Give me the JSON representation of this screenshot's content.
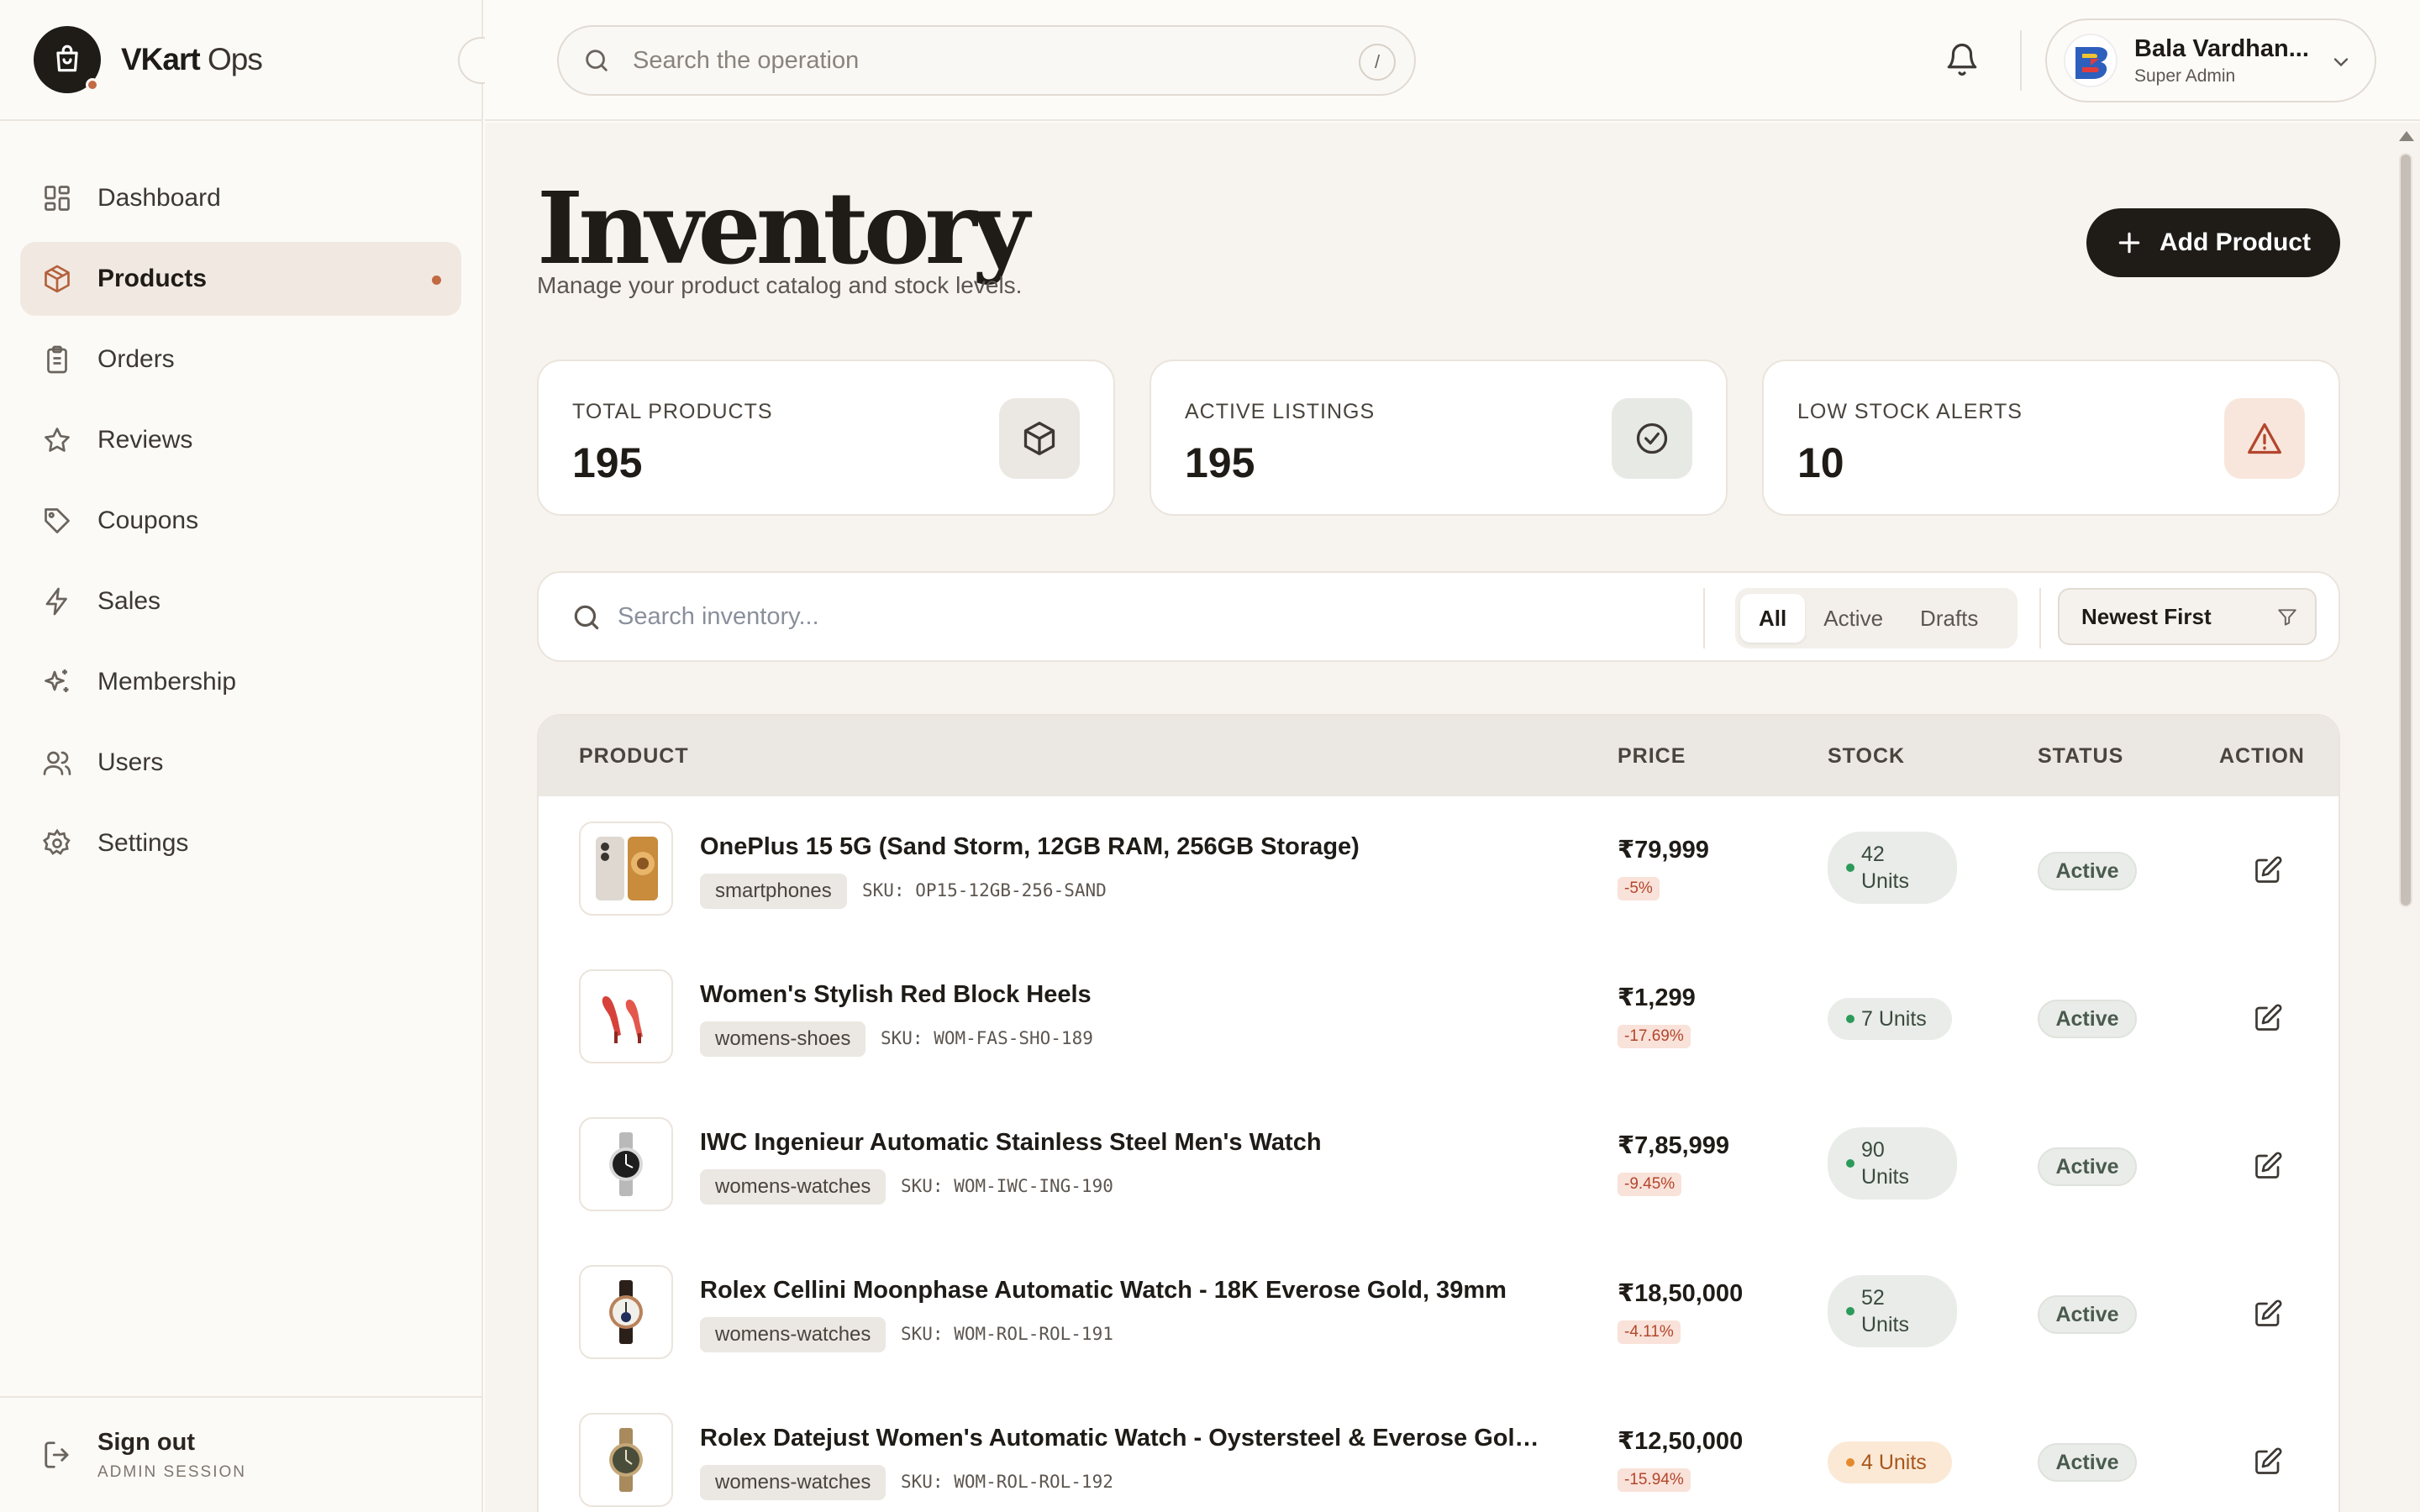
{
  "brand": {
    "bold": "VKart",
    "light": " Ops"
  },
  "nav": [
    {
      "label": "Dashboard",
      "icon": "dashboard-icon"
    },
    {
      "label": "Products",
      "icon": "box-icon",
      "active": true
    },
    {
      "label": "Orders",
      "icon": "clipboard-icon"
    },
    {
      "label": "Reviews",
      "icon": "star-icon"
    },
    {
      "label": "Coupons",
      "icon": "tag-icon"
    },
    {
      "label": "Sales",
      "icon": "lightning-icon"
    },
    {
      "label": "Membership",
      "icon": "sparkle-icon"
    },
    {
      "label": "Users",
      "icon": "users-icon"
    },
    {
      "label": "Settings",
      "icon": "gear-icon"
    }
  ],
  "signout": {
    "label": "Sign out",
    "sub": "ADMIN SESSION"
  },
  "topbar": {
    "search_placeholder": "Search the operation",
    "shortcut": "/",
    "user_name": "Bala Vardhan...",
    "user_role": "Super Admin"
  },
  "page": {
    "title": "Inventory",
    "subtitle": "Manage your product catalog and stock levels.",
    "add_label": "Add Product"
  },
  "stats": [
    {
      "label": "TOTAL PRODUCTS",
      "value": "195",
      "icon": "cube-icon"
    },
    {
      "label": "ACTIVE LISTINGS",
      "value": "195",
      "icon": "check-circle-icon"
    },
    {
      "label": "LOW STOCK ALERTS",
      "value": "10",
      "icon": "warning-icon"
    }
  ],
  "filters": {
    "search_placeholder": "Search inventory...",
    "tabs": [
      "All",
      "Active",
      "Drafts"
    ],
    "selected_tab": "All",
    "sort": "Newest First"
  },
  "table": {
    "headers": {
      "product": "PRODUCT",
      "price": "PRICE",
      "stock": "STOCK",
      "status": "STATUS",
      "action": "ACTION"
    },
    "rows": [
      {
        "name": "OnePlus 15 5G (Sand Storm, 12GB RAM, 256GB Storage)",
        "category": "smartphones",
        "sku": "SKU: OP15-12GB-256-SAND",
        "price": "₹79,999",
        "discount": "-5%",
        "stock_line1": "42",
        "stock_line2": "Units",
        "stock_level": "ok",
        "status": "Active",
        "thumb": "phone-image"
      },
      {
        "name": "Women's Stylish Red Block Heels",
        "category": "womens-shoes",
        "sku": "SKU: WOM-FAS-SHO-189",
        "price": "₹1,299",
        "discount": "-17.69%",
        "stock_line1": "7 Units",
        "stock_line2": "",
        "stock_level": "ok",
        "status": "Active",
        "thumb": "heels-image"
      },
      {
        "name": "IWC Ingenieur Automatic Stainless Steel Men's Watch",
        "category": "womens-watches",
        "sku": "SKU: WOM-IWC-ING-190",
        "price": "₹7,85,999",
        "discount": "-9.45%",
        "stock_line1": "90",
        "stock_line2": "Units",
        "stock_level": "ok",
        "status": "Active",
        "thumb": "watch-image"
      },
      {
        "name": "Rolex Cellini Moonphase Automatic Watch - 18K Everose Gold, 39mm",
        "category": "womens-watches",
        "sku": "SKU: WOM-ROL-ROL-191",
        "price": "₹18,50,000",
        "discount": "-4.11%",
        "stock_line1": "52",
        "stock_line2": "Units",
        "stock_level": "ok",
        "status": "Active",
        "thumb": "watch-image"
      },
      {
        "name": "Rolex Datejust Women's Automatic Watch - Oystersteel & Everose Gold,...",
        "category": "womens-watches",
        "sku": "SKU: WOM-ROL-ROL-192",
        "price": "₹12,50,000",
        "discount": "-15.94%",
        "stock_line1": "4 Units",
        "stock_line2": "",
        "stock_level": "low",
        "status": "Active",
        "thumb": "watch-image"
      }
    ]
  }
}
